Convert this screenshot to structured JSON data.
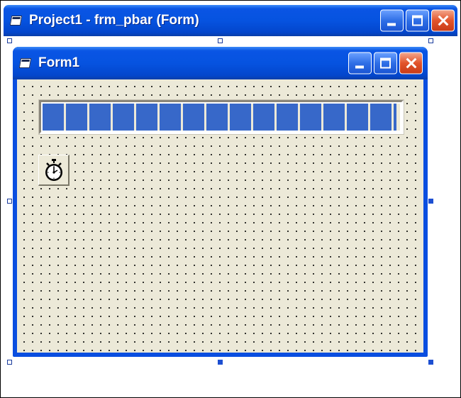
{
  "outer_window": {
    "title": "Project1 - frm_pbar (Form)",
    "icon": "form-icon"
  },
  "form_window": {
    "title": "Form1",
    "icon": "form-icon"
  },
  "title_buttons": {
    "minimize": "minimize-icon",
    "maximize": "maximize-icon",
    "close": "close-icon"
  },
  "progress_bar": {
    "value_percent": 99
  },
  "timer_control": {
    "icon": "stopwatch-icon"
  },
  "colors": {
    "titlebar": "#0653e0",
    "form_background": "#ece9d8",
    "progress_fill": "#3768c9",
    "close_button": "#e2542b"
  }
}
